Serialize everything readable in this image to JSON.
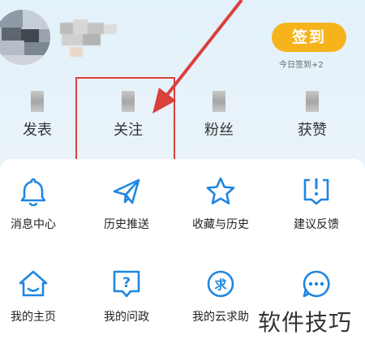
{
  "header": {
    "checkin_label": "签到",
    "checkin_sub": "今日签到+2"
  },
  "stats": [
    {
      "label": "发表"
    },
    {
      "label": "关注"
    },
    {
      "label": "粉丝"
    },
    {
      "label": "获赞"
    }
  ],
  "menu": [
    {
      "label": "消息中心",
      "icon": "bell-icon"
    },
    {
      "label": "历史推送",
      "icon": "paper-plane-icon"
    },
    {
      "label": "收藏与历史",
      "icon": "star-icon"
    },
    {
      "label": "建议反馈",
      "icon": "feedback-icon"
    },
    {
      "label": "我的主页",
      "icon": "home-icon"
    },
    {
      "label": "我的问政",
      "icon": "question-icon"
    },
    {
      "label": "我的云求助",
      "icon": "help-request-icon"
    },
    {
      "label": "",
      "icon": "more-icon"
    }
  ],
  "watermark": "软件技巧",
  "colors": {
    "accent": "#1f86e0",
    "checkin": "#f6b31c",
    "highlight": "#d9413c"
  }
}
